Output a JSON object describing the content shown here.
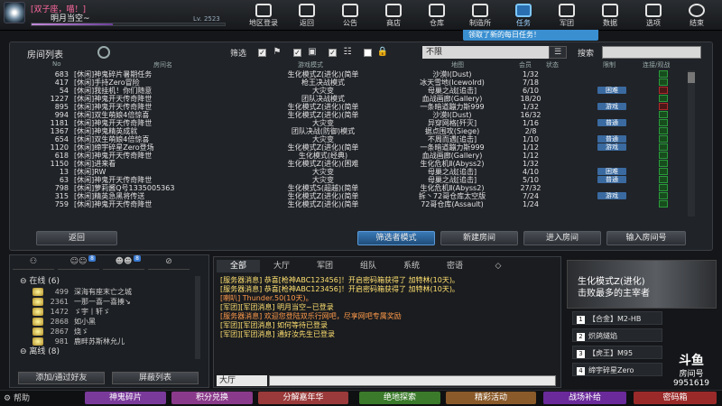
{
  "profile": {
    "title_badge": "[双子座，喵！]",
    "name": "明月当空~",
    "level_text": "Lv. 2523",
    "xp_fraction": 0.42
  },
  "nav": [
    {
      "label": "地区登录",
      "icon": "monitor-icon"
    },
    {
      "label": "返回",
      "icon": "back-icon"
    },
    {
      "label": "公告",
      "icon": "megaphone-icon"
    },
    {
      "label": "商店",
      "icon": "shop-icon"
    },
    {
      "label": "仓库",
      "icon": "inventory-icon"
    },
    {
      "label": "制造所",
      "icon": "factory-icon"
    },
    {
      "label": "任务",
      "icon": "task-icon"
    },
    {
      "label": "军团",
      "icon": "clan-icon"
    },
    {
      "label": "数据",
      "icon": "stats-icon"
    },
    {
      "label": "选项",
      "icon": "gear-icon"
    },
    {
      "label": "结束",
      "icon": "power-icon"
    }
  ],
  "quest_notice": "领取了新的每日任务！",
  "room_panel": {
    "title": "房间列表",
    "filter_label": "筛选",
    "mode_select": "不限",
    "search_label": "搜索",
    "search_value": ""
  },
  "columns": [
    "No",
    "房间名",
    "游戏模式",
    "地图",
    "会员",
    "状态",
    "限制",
    "连接/观战"
  ],
  "rooms": [
    {
      "no": "683",
      "name": "[休闲]神鬼碎片暑期任务",
      "mode": "生化模式Z(进化)(简单",
      "map": "沙漠Ⅰ(Dust)",
      "count": "1/32",
      "tag": ""
    },
    {
      "no": "417",
      "name": "[休闲]手持Zero冒险",
      "mode": "枪王决战模式",
      "map": "冰天雪地(Icewolrd)",
      "count": "7/18",
      "tag": ""
    },
    {
      "no": "54",
      "name": "[休闲]我挂机！你们随意",
      "mode": "大灾变",
      "map": "母巢之战[追击]",
      "count": "6/10",
      "tag": "困难"
    },
    {
      "no": "1227",
      "name": "[休闲]神鬼开天传奇降世",
      "mode": "团队决战模式",
      "map": "血战画廊(Gallery)",
      "count": "18/20",
      "tag": ""
    },
    {
      "no": "895",
      "name": "[休闲]神鬼开天传奇降世",
      "mode": "生化模式Z(进化)(简单",
      "map": "一条暗道蹦力斯999",
      "count": "1/32",
      "tag": "游戏"
    },
    {
      "no": "994",
      "name": "[休闲]双生萌娘4倍惊喜",
      "mode": "生化模式Z(进化)(简单",
      "map": "沙漠Ⅰ(Dust)",
      "count": "16/32",
      "tag": ""
    },
    {
      "no": "1181",
      "name": "[休闲]神鬼开天传奇降世",
      "mode": "大灾变",
      "map": "异穿网格[歼灭]",
      "count": "1/16",
      "tag": "普通"
    },
    {
      "no": "1367",
      "name": "[休闲]神鬼精英成就",
      "mode": "团队决战(防御)模式",
      "map": "据点围攻(Siege)",
      "count": "2/8",
      "tag": ""
    },
    {
      "no": "654",
      "name": "[休闲]双生萌娘4倍惊喜",
      "mode": "大灾变",
      "map": "不周而遇[追击]",
      "count": "1/10",
      "tag": "普通"
    },
    {
      "no": "1120",
      "name": "[休闲]缔宇碎星Zero登场",
      "mode": "生化模式Z(进化)(简单",
      "map": "一条暗道蹦力斯999",
      "count": "1/12",
      "tag": "游戏"
    },
    {
      "no": "618",
      "name": "[休闲]神鬼开天传奇降世",
      "mode": "生化模式(经典)",
      "map": "血战画廊(Gallery)",
      "count": "1/12",
      "tag": ""
    },
    {
      "no": "1150",
      "name": "[休闲]进来看",
      "mode": "生化模式Z(进化)(困难",
      "map": "生化危机Ⅱ(Abyss2)",
      "count": "1/32",
      "tag": ""
    },
    {
      "no": "13",
      "name": "[休闲]RW",
      "mode": "大灾变",
      "map": "母巢之战[追击]",
      "count": "4/10",
      "tag": "困难"
    },
    {
      "no": "63",
      "name": "[休闲]神鬼开天传奇降世",
      "mode": "大灾变",
      "map": "母巢之战[追击]",
      "count": "5/10",
      "tag": "普通"
    },
    {
      "no": "798",
      "name": "[休闲]萝莉酱Q号1335005363",
      "mode": "生化模式S(超越)(简单",
      "map": "生化危机Ⅱ(Abyss2)",
      "count": "27/32",
      "tag": ""
    },
    {
      "no": "315",
      "name": "[休闲]精英急黑将传送",
      "mode": "生化模式Z(进化)(简单",
      "map": "拆丶72哥仓库太空版",
      "count": "7/24",
      "tag": "游戏"
    },
    {
      "no": "759",
      "name": "[休闲]神鬼开天传奇降世",
      "mode": "生化模式Z(进化)(简单",
      "map": "72哥仓库(Assault)",
      "count": "1/24",
      "tag": ""
    }
  ],
  "actions": {
    "back": "返回",
    "filter_mode": "筛选者模式",
    "new_room": "新建房间",
    "enter_room": "进入房间",
    "room_number": "输入房间号"
  },
  "friends": {
    "tabs": [
      {
        "label": "",
        "badge": ""
      },
      {
        "label": "",
        "badge": "8"
      },
      {
        "label": "",
        "badge": "8"
      },
      {
        "label": "",
        "badge": ""
      }
    ],
    "online_label": "在线 (6)",
    "offline_label": "离线 (8)",
    "list": [
      {
        "num": "499",
        "name": "深海有座末亡之城"
      },
      {
        "num": "2361",
        "name": "一那一喜一喜揍↘"
      },
      {
        "num": "1472",
        "name": "ゞ宇丨轩ゞ"
      },
      {
        "num": "2868",
        "name": "如小黑"
      },
      {
        "num": "2867",
        "name": "烧ゞ"
      },
      {
        "num": "981",
        "name": "鹿畔苏斯林允儿"
      }
    ],
    "add_btn": "添加/通过好友",
    "block_btn": "屏蔽列表"
  },
  "chat": {
    "tabs": [
      "全部",
      "大厅",
      "军团",
      "组队",
      "系统",
      "密语",
      "◇"
    ],
    "messages": [
      {
        "type": "sys",
        "text": "[服务器消息] 恭喜[枪神ABC123456]！开启密码箱获得了 加特林(10天)。"
      },
      {
        "type": "sys",
        "text": "[服务器消息] 恭喜[枪神ABC123456]！开启密码箱获得了 加特林(10天)。"
      },
      {
        "type": "p",
        "text": "[喇叭] Thunder.50(10天)。"
      },
      {
        "type": "sys",
        "text": "[军团][军团消息] 明月当空~已登录"
      },
      {
        "type": "p",
        "text": "[服务器消息] 欢迎您登陆双乐行网吧，尽享网吧专属奖励"
      },
      {
        "type": "sys",
        "text": "[军团][军团消息] 如何等待已登录"
      },
      {
        "type": "sys",
        "text": "[军团][军团消息] 通好汝先生已登录"
      }
    ],
    "channel": "大厅"
  },
  "promo": {
    "line1": "生化模式Z(进化)",
    "line2": "击败最多的主宰者"
  },
  "ranks": [
    {
      "n": "1",
      "text": "【合金】M2-HB"
    },
    {
      "n": "2",
      "text": "炽鸽燧焰"
    },
    {
      "n": "3",
      "text": "【虎王】M95"
    },
    {
      "n": "4",
      "text": "缔宇碎星Zero"
    }
  ],
  "logo": {
    "brand": "斗鱼",
    "label": "房间号",
    "room": "9951619"
  },
  "bottom": [
    {
      "label": "帮助",
      "color": "#2a2c30"
    },
    {
      "label": "神鬼碎片",
      "color": "#7a3a9a"
    },
    {
      "label": "积分兑换",
      "color": "#8a3a8a"
    },
    {
      "label": "分解嘉年华",
      "color": "#9a3a3a"
    },
    {
      "label": "绝地探索",
      "color": "#3a7a2a"
    },
    {
      "label": "精彩活动",
      "color": "#8a5a2a"
    },
    {
      "label": "战场补给",
      "color": "#6a2a9a"
    },
    {
      "label": "密码箱",
      "color": "#9a2a2a"
    }
  ]
}
